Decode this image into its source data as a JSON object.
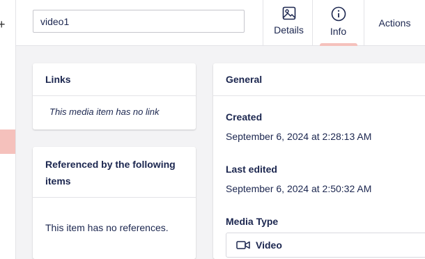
{
  "header": {
    "name_value": "video1",
    "tabs": [
      {
        "label": "Details",
        "icon": "image-icon"
      },
      {
        "label": "Info",
        "icon": "info-icon"
      },
      {
        "label": "Actions"
      }
    ]
  },
  "links_card": {
    "title": "Links",
    "empty_text": "This media item has no link"
  },
  "references_card": {
    "title": "Referenced by the following items",
    "empty_text": "This item has no references."
  },
  "general_card": {
    "title": "General",
    "created_label": "Created",
    "created_value": "September 6, 2024 at 2:28:13 AM",
    "edited_label": "Last edited",
    "edited_value": "September 6, 2024 at 2:50:32 AM",
    "media_type_label": "Media Type",
    "media_type_value": "Video",
    "media_type_icon": "video-camera-icon"
  },
  "colors": {
    "text": "#1b264f",
    "accent": "#f5c1bc",
    "background": "#f3f3f5"
  }
}
